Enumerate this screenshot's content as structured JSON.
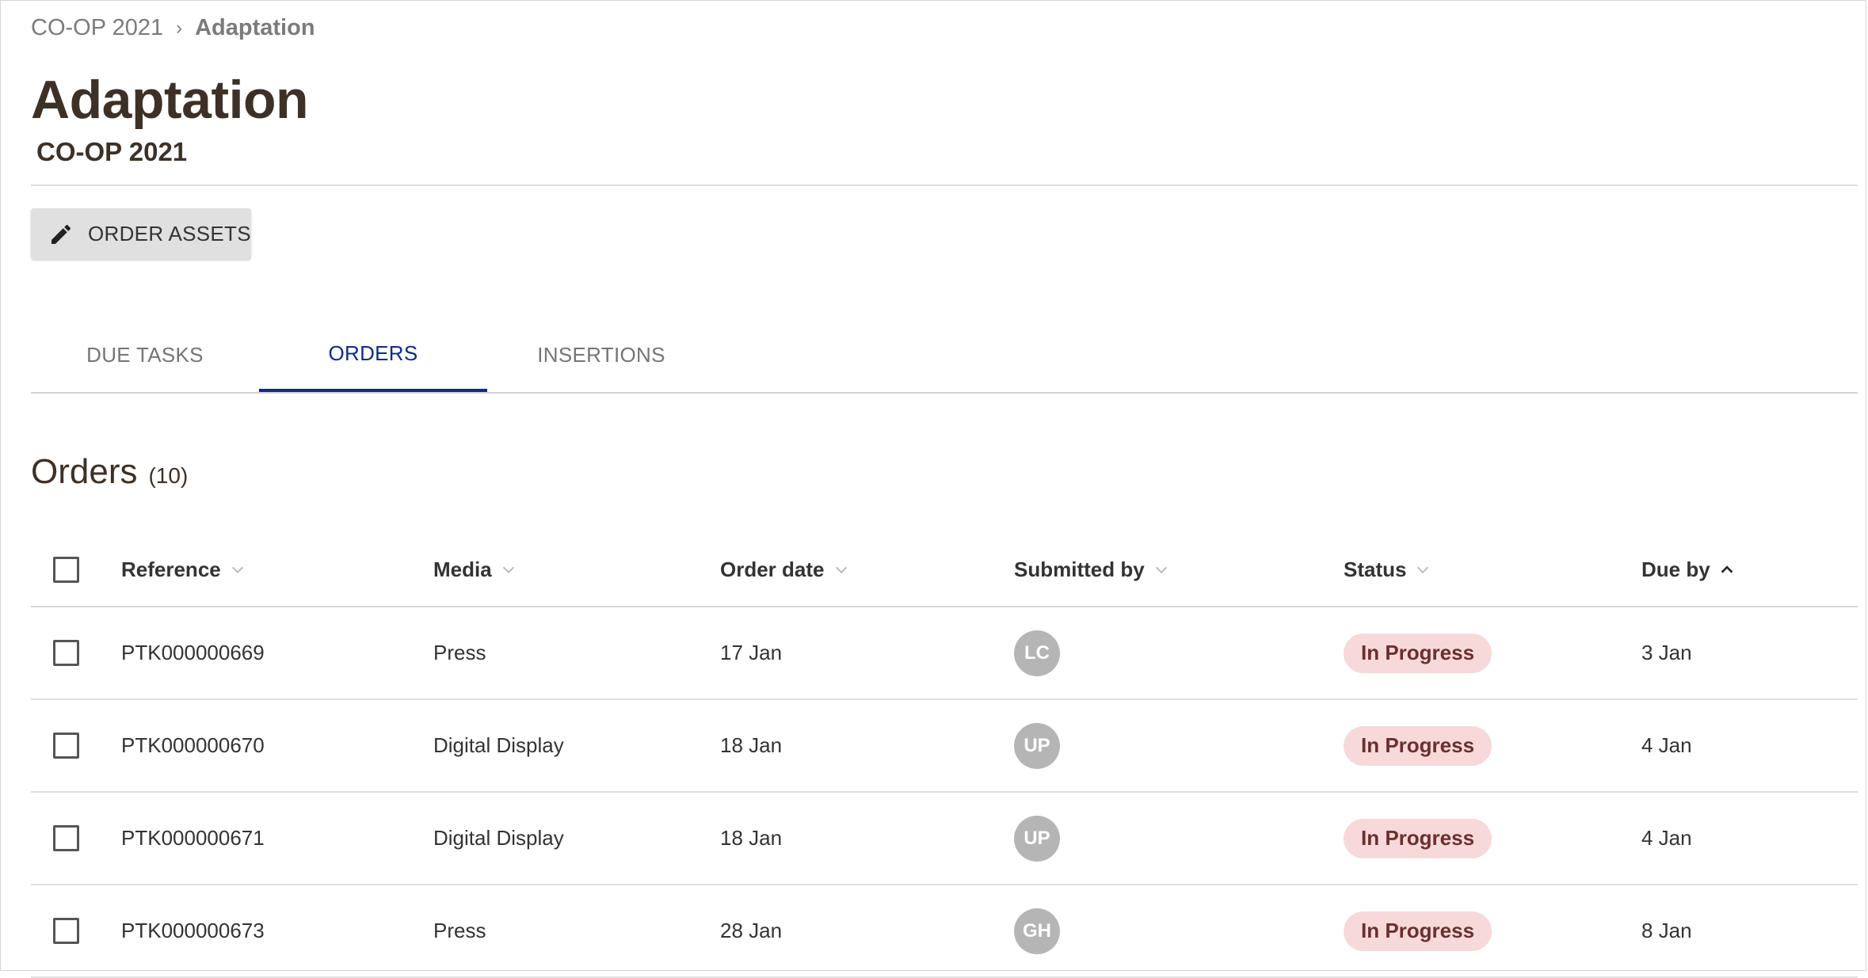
{
  "breadcrumb": {
    "parent": "CO-OP 2021",
    "separator": "›",
    "current": "Adaptation"
  },
  "header": {
    "title": "Adaptation",
    "subtitle": "CO-OP 2021"
  },
  "toolbar": {
    "order_assets_label": "ORDER ASSETS",
    "order_assets_icon": "pencil-icon"
  },
  "tabs": [
    {
      "label": "DUE TASKS",
      "active": false
    },
    {
      "label": "ORDERS",
      "active": true
    },
    {
      "label": "INSERTIONS",
      "active": false
    }
  ],
  "orders": {
    "title": "Orders",
    "count": "(10)",
    "columns": {
      "reference": "Reference",
      "media": "Media",
      "order_date": "Order date",
      "submitted_by": "Submitted by",
      "status": "Status",
      "due_by": "Due by"
    },
    "rows": [
      {
        "reference": "PTK000000669",
        "media": "Press",
        "order_date": "17 Jan",
        "submitted_by": "LC",
        "status": "In Progress",
        "due_by": "3 Jan"
      },
      {
        "reference": "PTK000000670",
        "media": "Digital Display",
        "order_date": "18 Jan",
        "submitted_by": "UP",
        "status": "In Progress",
        "due_by": "4 Jan"
      },
      {
        "reference": "PTK000000671",
        "media": "Digital Display",
        "order_date": "18 Jan",
        "submitted_by": "UP",
        "status": "In Progress",
        "due_by": "4 Jan"
      },
      {
        "reference": "PTK000000673",
        "media": "Press",
        "order_date": "28 Jan",
        "submitted_by": "GH",
        "status": "In Progress",
        "due_by": "8 Jan"
      }
    ]
  },
  "colors": {
    "accent": "#0d2b8c",
    "title_text": "#3d3127",
    "status_bg": "#f7d9d9",
    "status_text": "#6b2f2f",
    "avatar_bg": "#b5b5b5"
  }
}
